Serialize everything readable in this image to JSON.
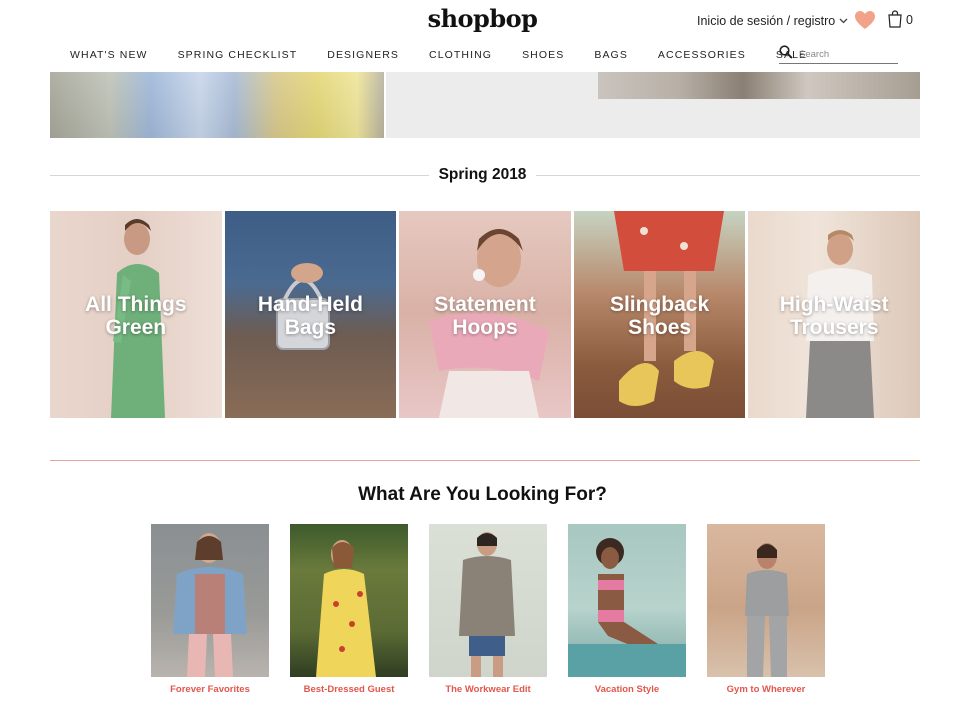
{
  "header": {
    "logo": "shopbop",
    "account_label": "Inicio de sesión / registro",
    "bag_count": "0"
  },
  "nav": {
    "items": [
      "What's New",
      "Spring Checklist",
      "Designers",
      "Clothing",
      "Shoes",
      "Bags",
      "Accessories",
      "Sale"
    ],
    "search_placeholder": "Search"
  },
  "spring": {
    "title": "Spring 2018",
    "tiles": [
      "All Things Green",
      "Hand-Held Bags",
      "Statement Hoops",
      "Slingback Shoes",
      "High-Waist Trousers"
    ]
  },
  "looking": {
    "title": "What Are You Looking For?",
    "cards": [
      "Forever Favorites",
      "Best-Dressed Guest",
      "The Workwear Edit",
      "Vacation Style",
      "Gym to Wherever"
    ]
  },
  "colors": {
    "accent": "#e2574c",
    "heart": "#f2a288",
    "divider": "#e5a79c"
  },
  "icons": [
    "heart-icon",
    "shopping-bag-icon",
    "search-icon",
    "chevron-down-icon"
  ]
}
